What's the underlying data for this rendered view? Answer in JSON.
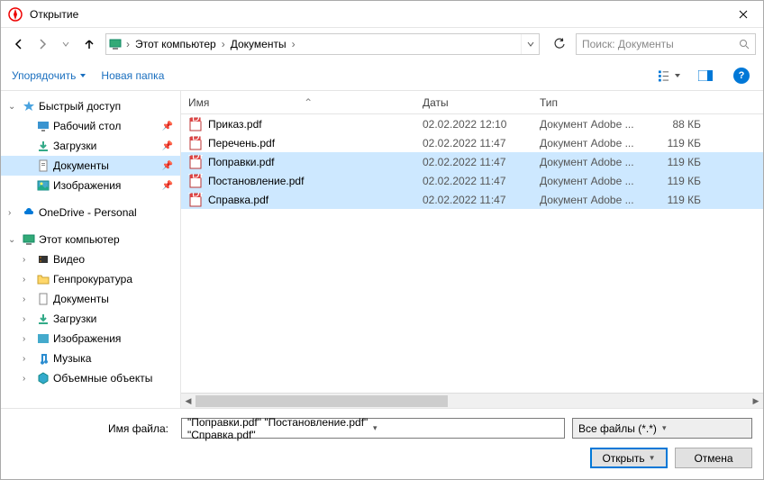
{
  "title": "Открытие",
  "breadcrumb": {
    "root": "Этот компьютер",
    "folder": "Документы"
  },
  "search_placeholder": "Поиск: Документы",
  "toolbar": {
    "organize": "Упорядочить",
    "new_folder": "Новая папка"
  },
  "columns": {
    "name": "Имя",
    "date": "Даты",
    "type": "Тип"
  },
  "tree": {
    "quick_access": "Быстрый доступ",
    "desktop": "Рабочий стол",
    "downloads": "Загрузки",
    "documents": "Документы",
    "pictures": "Изображения",
    "onedrive": "OneDrive - Personal",
    "this_pc": "Этот компьютер",
    "videos": "Видео",
    "genpros": "Генпрокуратура",
    "documents2": "Документы",
    "downloads2": "Загрузки",
    "pictures2": "Изображения",
    "music": "Музыка",
    "volumes": "Объемные объекты"
  },
  "files": [
    {
      "name": "Приказ.pdf",
      "date": "02.02.2022 12:10",
      "type": "Документ Adobe ...",
      "size": "88 КБ",
      "selected": false
    },
    {
      "name": "Перечень.pdf",
      "date": "02.02.2022 11:47",
      "type": "Документ Adobe ...",
      "size": "119 КБ",
      "selected": false
    },
    {
      "name": "Поправки.pdf",
      "date": "02.02.2022 11:47",
      "type": "Документ Adobe ...",
      "size": "119 КБ",
      "selected": true
    },
    {
      "name": "Постановление.pdf",
      "date": "02.02.2022 11:47",
      "type": "Документ Adobe ...",
      "size": "119 КБ",
      "selected": true
    },
    {
      "name": "Справка.pdf",
      "date": "02.02.2022 11:47",
      "type": "Документ Adobe ...",
      "size": "119 КБ",
      "selected": true
    }
  ],
  "filename_label": "Имя файла:",
  "filename_value": "\"Поправки.pdf\" \"Постановление.pdf\" \"Справка.pdf\"",
  "filetype": "Все файлы (*.*)",
  "open_btn": "Открыть",
  "cancel_btn": "Отмена"
}
